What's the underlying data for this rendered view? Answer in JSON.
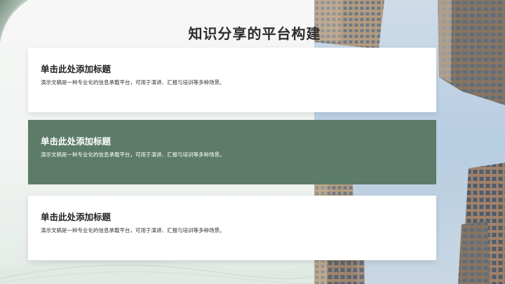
{
  "slide": {
    "title": "知识分享的平台构建",
    "cards": [
      {
        "title": "单击此处添加标题",
        "description": "演示文稿是一种专业化的信息承载平台，可用于演讲、汇报与培训等多种场景。"
      },
      {
        "title": "单击此处添加标题",
        "description": "演示文稿是一种专业化的信息承载平台，可用于演讲、汇报与培训等多种场景。"
      },
      {
        "title": "单击此处添加标题",
        "description": "演示文稿是一种专业化的信息承载平台，可用于演讲、汇报与培训等多种场景。"
      }
    ]
  },
  "colors": {
    "accent_green": "#5c7b68",
    "card_white": "#ffffff",
    "title_text": "#2e2e2e",
    "sky": "#bcd3e6"
  },
  "images": {
    "background_photo": "city-skyscrapers-photo"
  }
}
